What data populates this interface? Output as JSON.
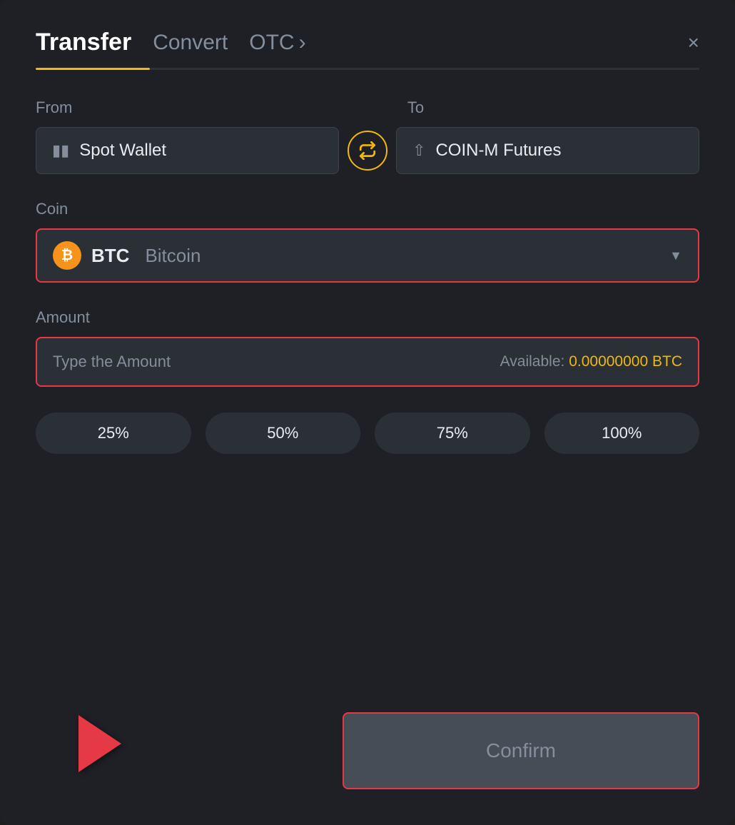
{
  "header": {
    "tab_transfer": "Transfer",
    "tab_convert": "Convert",
    "tab_otc": "OTC",
    "close_label": "×"
  },
  "from_section": {
    "label": "From",
    "wallet_name": "Spot Wallet"
  },
  "to_section": {
    "label": "To",
    "wallet_name": "COIN-M Futures"
  },
  "coin_section": {
    "label": "Coin",
    "coin_symbol": "BTC",
    "coin_name": "Bitcoin"
  },
  "amount_section": {
    "label": "Amount",
    "placeholder": "Type the Amount",
    "available_label": "Available:",
    "available_value": "0.00000000 BTC"
  },
  "percent_buttons": [
    "25%",
    "50%",
    "75%",
    "100%"
  ],
  "confirm_button": "Confirm"
}
